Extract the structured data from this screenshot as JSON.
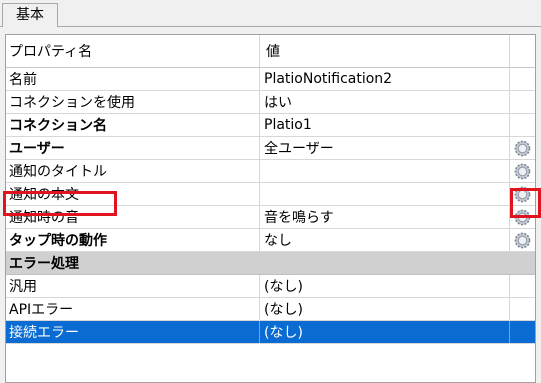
{
  "tab": {
    "label": "基本"
  },
  "header": {
    "name_col": "プロパティ名",
    "value_col": "値"
  },
  "rows": [
    {
      "name": "名前",
      "value": "PlatioNotification2",
      "bold": false,
      "has_button": false
    },
    {
      "name": "コネクションを使用",
      "value": "はい",
      "bold": false,
      "has_button": false
    },
    {
      "name": "コネクション名",
      "value": "Platio1",
      "bold": true,
      "has_button": false
    },
    {
      "name": "ユーザー",
      "value": "全ユーザー",
      "bold": true,
      "has_button": true
    },
    {
      "name": "通知のタイトル",
      "value": "",
      "bold": false,
      "has_button": true
    },
    {
      "name": "通知の本文",
      "value": "",
      "bold": false,
      "has_button": true
    },
    {
      "name": "通知時の音",
      "value": "音を鳴らす",
      "bold": false,
      "has_button": true
    },
    {
      "name": "タップ時の動作",
      "value": "なし",
      "bold": true,
      "has_button": true
    }
  ],
  "category": {
    "name": "エラー処理"
  },
  "error_rows": [
    {
      "name": "汎用",
      "value": "(なし)"
    },
    {
      "name": "APIエラー",
      "value": "(なし)"
    },
    {
      "name": "接続エラー",
      "value": "(なし)",
      "selected": true
    }
  ],
  "colors": {
    "highlight": "#e0141e",
    "selection": "#0a6bd3",
    "category_bg": "#d0d0d0"
  },
  "icon": {
    "ellipsis_button": "gear-icon"
  }
}
